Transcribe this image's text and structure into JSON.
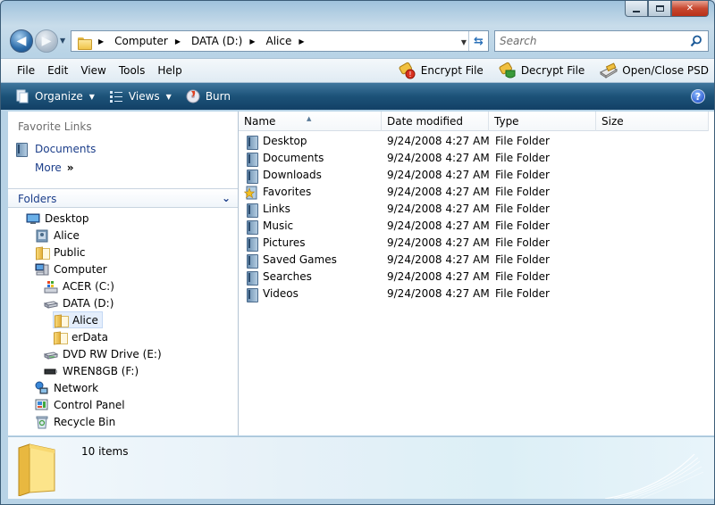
{
  "window": {
    "min_icon": "minimize-icon",
    "max_icon": "maximize-icon",
    "close_icon": "close-icon"
  },
  "address": {
    "crumbs": [
      "Computer",
      "DATA (D:)",
      "Alice"
    ],
    "search_placeholder": "Search"
  },
  "menu": {
    "items": [
      "File",
      "Edit",
      "View",
      "Tools",
      "Help"
    ],
    "actions": [
      "Encrypt File",
      "Decrypt File",
      "Open/Close PSD"
    ]
  },
  "commands": {
    "organize": "Organize",
    "views": "Views",
    "burn": "Burn"
  },
  "favorites": {
    "header": "Favorite Links",
    "items": [
      "Documents"
    ],
    "more": "More",
    "more_chevron": "»"
  },
  "folders": {
    "header": "Folders",
    "tree": [
      "Desktop",
      "Alice",
      "Public",
      "Computer",
      "ACER (C:)",
      "DATA (D:)",
      "Alice",
      "erData",
      "DVD RW Drive (E:)",
      "WREN8GB (F:)",
      "Network",
      "Control Panel",
      "Recycle Bin"
    ],
    "selected": "Alice"
  },
  "list": {
    "columns": [
      "Name",
      "Date modified",
      "Type",
      "Size"
    ],
    "rows": [
      {
        "name": "Desktop",
        "date": "9/24/2008 4:27 AM",
        "type": "File Folder",
        "icon": "desktop-folder-icon"
      },
      {
        "name": "Documents",
        "date": "9/24/2008 4:27 AM",
        "type": "File Folder",
        "icon": "documents-folder-icon"
      },
      {
        "name": "Downloads",
        "date": "9/24/2008 4:27 AM",
        "type": "File Folder",
        "icon": "downloads-folder-icon"
      },
      {
        "name": "Favorites",
        "date": "9/24/2008 4:27 AM",
        "type": "File Folder",
        "icon": "favorites-folder-icon"
      },
      {
        "name": "Links",
        "date": "9/24/2008 4:27 AM",
        "type": "File Folder",
        "icon": "links-folder-icon"
      },
      {
        "name": "Music",
        "date": "9/24/2008 4:27 AM",
        "type": "File Folder",
        "icon": "music-folder-icon"
      },
      {
        "name": "Pictures",
        "date": "9/24/2008 4:27 AM",
        "type": "File Folder",
        "icon": "pictures-folder-icon"
      },
      {
        "name": "Saved Games",
        "date": "9/24/2008 4:27 AM",
        "type": "File Folder",
        "icon": "saved-games-folder-icon"
      },
      {
        "name": "Searches",
        "date": "9/24/2008 4:27 AM",
        "type": "File Folder",
        "icon": "searches-folder-icon"
      },
      {
        "name": "Videos",
        "date": "9/24/2008 4:27 AM",
        "type": "File Folder",
        "icon": "videos-folder-icon"
      }
    ]
  },
  "details": {
    "count": "10 items"
  },
  "colors": {
    "link": "#1c3e8a",
    "command_bar": "#1c5278",
    "selection": "#e4eefc"
  }
}
